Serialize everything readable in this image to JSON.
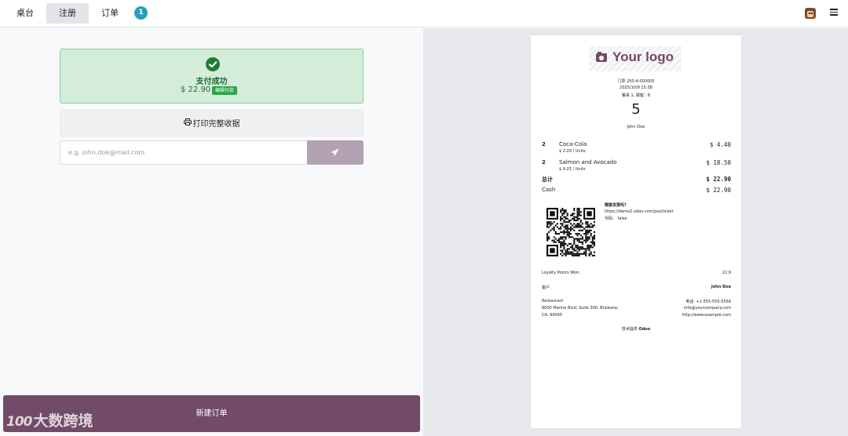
{
  "topbar": {
    "tabs": [
      {
        "label": "桌台",
        "active": false
      },
      {
        "label": "注册",
        "active": true
      },
      {
        "label": "订单",
        "active": false
      }
    ],
    "order_badge": "1",
    "avatar_icon": "user-avatar-icon",
    "menu_icon": "hamburger-menu-icon"
  },
  "payment": {
    "status_icon": "check-circle-icon",
    "title": "支付成功",
    "amount": "$ 22.90",
    "edit_label": "编辑付款",
    "print_label": "打印完整收据",
    "email_placeholder": "e.g. john.doe@mail.com",
    "send_icon": "paper-plane-icon",
    "new_order_label": "新建订单"
  },
  "watermark": {
    "logo": "100",
    "text": "大数跨境"
  },
  "receipt": {
    "logo_text": "Your logo",
    "ticket_line": "门票 250-4-000005",
    "datetime": "2025/10/9 15:38",
    "table_line": "餐桌 1, 顾客：8",
    "order_number": "5",
    "cashier": "John Doe",
    "lines": [
      {
        "qty": "2",
        "name": "Coca-Cola",
        "unit": "$ 2.20 / Units",
        "price": "$ 4.40"
      },
      {
        "qty": "2",
        "name": "Salmon and Avocado",
        "unit": "$ 9.25 / Units",
        "price": "$ 18.50"
      }
    ],
    "total_label": "总计",
    "total_value": "$ 22.90",
    "payment_method": "Cash",
    "payment_value": "$ 22.90",
    "invoice_title": "需要发票吗？",
    "invoice_url": "https://demo2.odoo.com/pos/ticket",
    "invoice_code": "代码： false",
    "loyalty_label": "Loyalty Points Won:",
    "loyalty_value": "22.9",
    "customer_label": "客户",
    "customer_name": "John Doe",
    "company_name": "Restaurant",
    "company_address_1": "8000 Marina Blvd, Suite 300, Brisbane,",
    "company_address_2": "CA, 94005",
    "company_phone": "电话: +1 555-555-5556",
    "company_email": "info@yourcompany.com",
    "company_web": "http://www.example.com",
    "powered_prefix": "技术提供",
    "powered_brand": "Odoo"
  }
}
